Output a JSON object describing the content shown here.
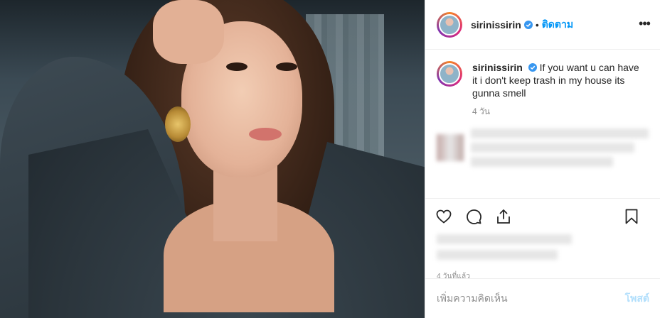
{
  "header": {
    "username": "sirinissirin",
    "separator": "•",
    "follow_label": "ติดตาม",
    "more_label": "•••"
  },
  "caption": {
    "username": "sirinissirin",
    "text": "If you want u can have it i don't keep trash in my house its gunna smell",
    "time": "4 วัน"
  },
  "actions": {
    "like": "heart-icon",
    "comment": "comment-icon",
    "share": "share-icon",
    "save": "bookmark-icon"
  },
  "post_time": "4 วันที่แล้ว",
  "add_comment": {
    "placeholder": "เพิ่มความคิดเห็น",
    "post_label": "โพสต์"
  },
  "colors": {
    "accent": "#0095f6",
    "verified": "#3897f0",
    "post_disabled": "#b2dffc"
  }
}
